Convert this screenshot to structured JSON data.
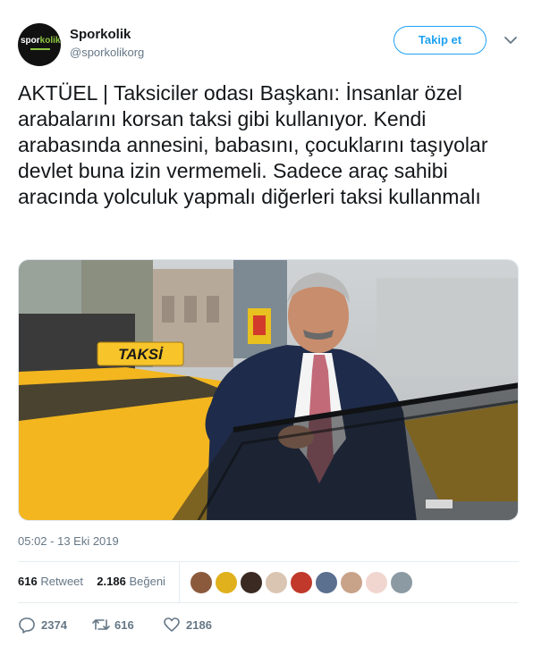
{
  "user": {
    "name": "Sporkolik",
    "handle": "@sporkolikorg",
    "avatar_text_white": "spor",
    "avatar_text_green": "kolik"
  },
  "header": {
    "follow_label": "Takip et"
  },
  "tweet": {
    "text": "AKTÜEL | Taksiciler odası Başkanı: İnsanlar özel arabalarını korsan taksi gibi kullanıyor. Kendi arabasında annesini, babasını, çocuklarını taşıyolar devlet buna izin vermemeli. Sadece araç sahibi aracında yolculuk yapmalı diğerleri taksi kullanmalı",
    "timestamp": "05:02 - 13 Eki 2019"
  },
  "media": {
    "taxi_sign": "TAKSİ"
  },
  "stats": {
    "retweets_count": "616",
    "retweets_label": "Retweet",
    "likes_count": "2.186",
    "likes_label": "Beğeni"
  },
  "actions": {
    "reply_count": "2374",
    "retweet_count": "616",
    "like_count": "2186"
  },
  "colors": {
    "accent": "#1da1f2",
    "secondary_text": "#657786",
    "taxi_yellow": "#f3b61f"
  }
}
